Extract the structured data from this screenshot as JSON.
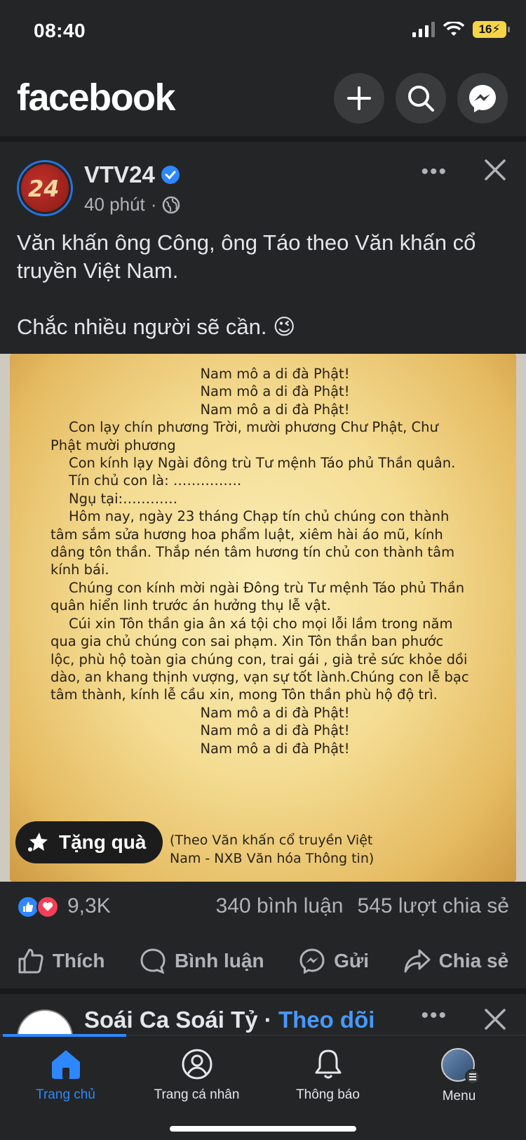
{
  "status": {
    "time": "08:40",
    "battery": "16"
  },
  "header": {
    "logo": "facebook",
    "icons": [
      "plus-icon",
      "search-icon",
      "messenger-icon"
    ]
  },
  "post": {
    "author": "VTV24",
    "time": "40 phút",
    "audience_icon": "globe-icon",
    "caption_line1": "Văn khấn ông Công, ông Táo theo Văn khấn cổ truyền Việt Nam.",
    "caption_line2": "Chắc nhiều người sẽ cần. 😉",
    "image_lines": [
      "Nam mô a di đà Phật!",
      "Nam mô a di đà Phật!",
      "Nam mô a di đà Phật!",
      "Con lạy chín phương Trời, mười phương Chư Phật, Chư Phật mười phương",
      "Con kính lạy Ngài đông trù Tư mệnh Táo phủ Thần quân.",
      "Tín chủ con là: ……………",
      "Ngụ tại:…………",
      "Hôm nay, ngày 23 tháng Chạp tín chủ chúng con thành tâm sắm sửa hương hoa phẩm luật, xiêm hài áo mũ, kính dâng tôn thần. Thắp nén tâm hương tín chủ con thành tâm kính bái.",
      "Chúng con kính mời ngài Đông trù Tư mệnh Táo phủ Thần quân hiển linh trước án hưởng thụ lễ vật.",
      "Cúi xin Tôn thần gia ân xá tội cho mọi lỗi lầm trong năm qua gia chủ chúng con sai phạm. Xin Tôn thần ban phước lộc, phù hộ toàn gia chúng con, trai gái , già trẻ sức khỏe dồi dào, an khang thịnh vượng, vạn sự tốt lành.Chúng con lễ bạc tâm thành, kính lễ cầu xin, mong Tôn thần phù hộ độ trì.",
      "Nam mô a di đà Phật!",
      "Nam mô a di đà Phật!",
      "Nam mô a di đà Phật!"
    ],
    "image_source_1": "(Theo Văn khấn cổ truyền Việt",
    "image_source_2": "Nam - NXB Văn hóa Thông tin)",
    "gift_label": "Tặng quà",
    "reaction_count": "9,3K",
    "comments": "340 bình luận",
    "shares": "545 lượt chia sẻ",
    "actions": {
      "like": "Thích",
      "comment": "Bình luận",
      "send": "Gửi",
      "share": "Chia sẻ"
    }
  },
  "next_post": {
    "author": "Soái Ca Soái Tỷ",
    "separator": "·",
    "follow": "Theo dõi"
  },
  "tabs": [
    {
      "label": "Trang chủ",
      "icon": "home-icon",
      "active": true
    },
    {
      "label": "Trang cá nhân",
      "icon": "profile-icon",
      "active": false
    },
    {
      "label": "Thông báo",
      "icon": "bell-icon",
      "active": false
    },
    {
      "label": "Menu",
      "icon": "avatar-icon",
      "active": false
    }
  ],
  "colors": {
    "background": "#242526",
    "accent": "#2d88ff",
    "text": "#e4e6eb",
    "muted": "#b0b3b8"
  }
}
